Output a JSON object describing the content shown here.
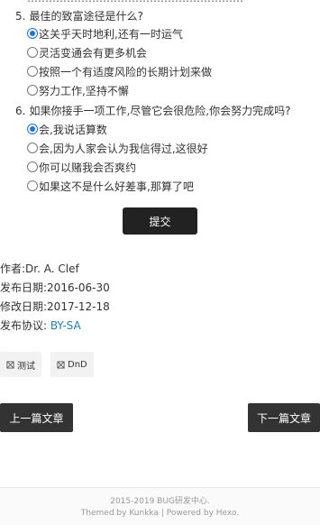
{
  "cut_line": "……………………………………………………",
  "q5": {
    "number": "5.",
    "text": "最佳的致富途径是什么?",
    "options": [
      {
        "label": "这关乎天时地利,还有一时运气",
        "checked": true
      },
      {
        "label": "灵活变通会有更多机会",
        "checked": false
      },
      {
        "label": "按照一个有适度风险的长期计划来做",
        "checked": false
      },
      {
        "label": "努力工作,坚持不懈",
        "checked": false
      }
    ]
  },
  "q6": {
    "number": "6.",
    "text": "如果你接手一项工作,尽管它会很危险,你会努力完成吗?",
    "options": [
      {
        "label": "会,我说话算数",
        "checked": true
      },
      {
        "label": "会,因为人家会认为我信得过,这很好",
        "checked": false
      },
      {
        "label": "你可以赌我会否爽约",
        "checked": false
      },
      {
        "label": "如果这不是什么好差事,那算了吧",
        "checked": false
      }
    ]
  },
  "submit_label": "提交",
  "meta": {
    "author": "作者:Dr. A. Clef",
    "published": "发布日期:2016-06-30",
    "modified": "修改日期:2017-12-18",
    "license_prefix": "发布协议: ",
    "license_link": "BY-SA"
  },
  "tags": [
    {
      "label": "测试",
      "icon": "tag-icon"
    },
    {
      "label": "DnD",
      "icon": "tag-icon"
    }
  ],
  "nav": {
    "prev": "上一篇文章",
    "next": "下一篇文章"
  },
  "footer": {
    "copyright": "2015-2019 BUG研发中心.",
    "themed_prefix": "Themed by ",
    "theme_name": "Kunkka",
    "separator": " | Powered by ",
    "powered_name": "Hexo",
    "suffix": "."
  },
  "colors": {
    "accent": "#1a73e8",
    "link": "#1a7dbf",
    "button_dark": "#333333"
  }
}
